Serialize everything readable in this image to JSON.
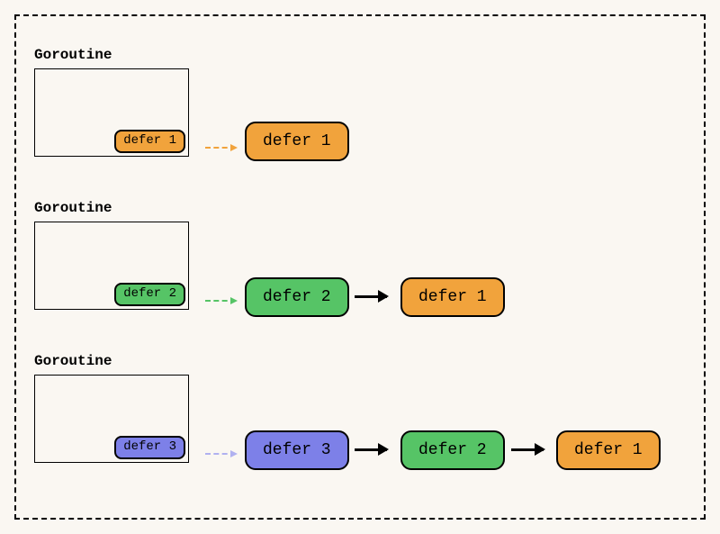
{
  "rows": [
    {
      "label": "Goroutine",
      "inner": {
        "text": "defer 1",
        "color": "orange"
      },
      "chain": [
        {
          "text": "defer 1",
          "color": "orange"
        }
      ],
      "dashColor": "orange"
    },
    {
      "label": "Goroutine",
      "inner": {
        "text": "defer 2",
        "color": "green"
      },
      "chain": [
        {
          "text": "defer 2",
          "color": "green"
        },
        {
          "text": "defer 1",
          "color": "orange"
        }
      ],
      "dashColor": "green"
    },
    {
      "label": "Goroutine",
      "inner": {
        "text": "defer 3",
        "color": "purple"
      },
      "chain": [
        {
          "text": "defer 3",
          "color": "purple"
        },
        {
          "text": "defer 2",
          "color": "green"
        },
        {
          "text": "defer 1",
          "color": "orange"
        }
      ],
      "dashColor": "purple"
    }
  ]
}
